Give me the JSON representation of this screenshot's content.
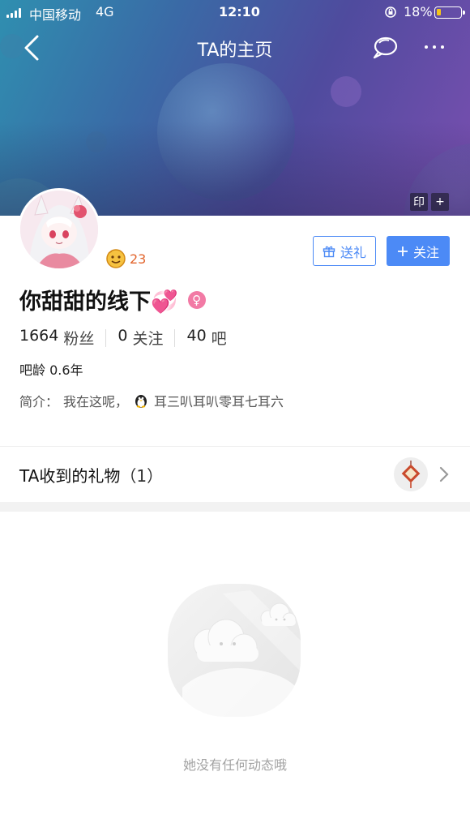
{
  "status_bar": {
    "carrier": "中国移动",
    "network": "4G",
    "time": "12:10",
    "battery_percent": "18%",
    "battery_level": 0.18,
    "battery_color": "#f5c518"
  },
  "nav": {
    "title": "TA的主页",
    "back_icon": "chevron-left-icon",
    "chat_icon": "chat-bubbles-icon",
    "more_icon": "more-dots-icon"
  },
  "banner": {
    "stamp_label": "印",
    "add_label": "+"
  },
  "profile": {
    "level": "23",
    "name": "你甜甜的线下💞",
    "gender_symbol": "♀",
    "gender_color": "#f27aa5",
    "fans_count": "1664",
    "fans_label": "粉丝",
    "following_count": "0",
    "following_label": "关注",
    "bars_count": "40",
    "bars_label": "吧",
    "age_label": "吧龄",
    "age_value": "0.6年",
    "intro_label": "简介：",
    "intro_text": "我在这呢，",
    "intro_qq": "耳三叭耳叭零耳七耳六"
  },
  "actions": {
    "gift_label": "送礼",
    "follow_label": "关注",
    "accent_color": "#4c8af6"
  },
  "gifts": {
    "title": "TA收到的礼物",
    "count": "（1）"
  },
  "feed": {
    "empty_text": "她没有任何动态哦"
  }
}
